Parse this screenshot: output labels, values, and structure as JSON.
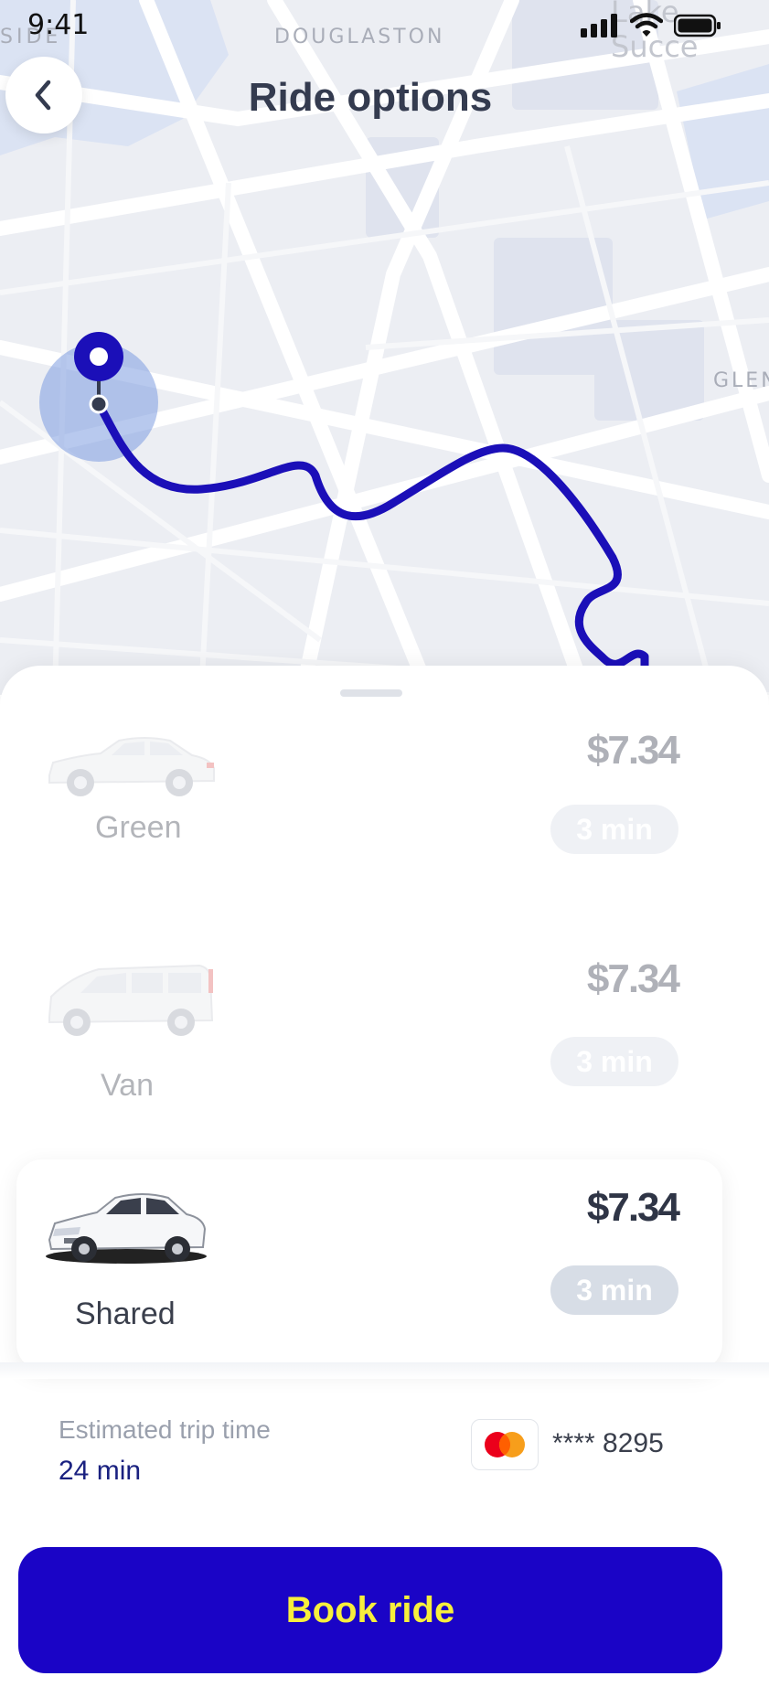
{
  "status_bar": {
    "time": "9:41"
  },
  "map": {
    "labels": {
      "douglaston": "DOUGLASTON",
      "side": "SIDE",
      "glen": "GLEN",
      "lake_success": "Lake Succe"
    },
    "route_color": "#1b0fb8",
    "pin_color": "#1b0fb8"
  },
  "header": {
    "title": "Ride options",
    "back_icon": "chevron-left-icon"
  },
  "ride_options": [
    {
      "name": "Green",
      "price": "$7.34",
      "eta": "3 min",
      "selected": false,
      "icon": "sedan-car-icon"
    },
    {
      "name": "Van",
      "price": "$7.34",
      "eta": "3 min",
      "selected": false,
      "icon": "van-icon"
    },
    {
      "name": "Shared",
      "price": "$7.34",
      "eta": "3 min",
      "selected": true,
      "icon": "sedan-car-icon"
    }
  ],
  "trip": {
    "estimated_label": "Estimated trip time",
    "estimated_value": "24 min"
  },
  "payment": {
    "card_icon": "mastercard-icon",
    "card_number": "**** 8295"
  },
  "book_button": {
    "label": "Book ride",
    "background": "#1a04c6",
    "text_color": "#f7ef3c"
  }
}
